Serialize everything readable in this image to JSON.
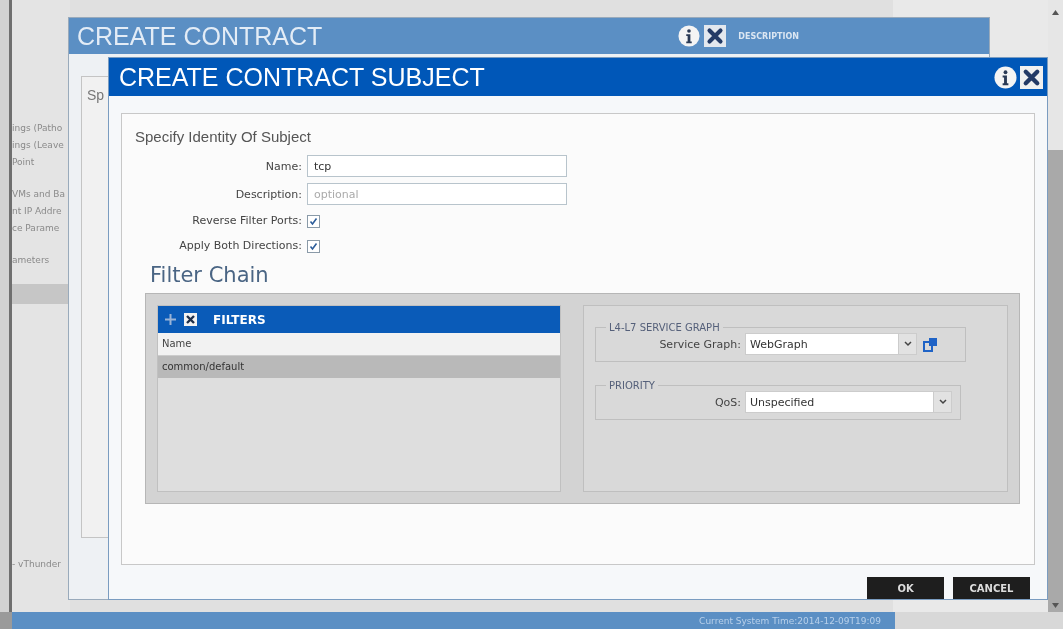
{
  "sidebar": {
    "groups": [
      [
        "ings (Patho",
        "ings (Leave",
        "Point"
      ],
      [
        "VMs and Ba",
        "nt IP Addre",
        "ce Parame"
      ],
      [
        "ameters"
      ]
    ],
    "footer_item": "- vThunder"
  },
  "background_dialog": {
    "title": "CREATE CONTRACT",
    "header_label": "DESCRIPTION",
    "panel_text": "Sp"
  },
  "dialog": {
    "title": "CREATE CONTRACT SUBJECT",
    "section_title": "Specify Identity Of Subject",
    "fields": [
      {
        "kind": "text",
        "label": "Name:",
        "value": "tcp"
      },
      {
        "kind": "text",
        "label": "Description:",
        "placeholder": "optional"
      },
      {
        "kind": "checkbox",
        "label": "Reverse Filter Ports:",
        "checked": true
      },
      {
        "kind": "checkbox",
        "label": "Apply Both Directions:",
        "checked": true
      }
    ],
    "filter_chain": {
      "title": "Filter Chain",
      "filters": {
        "title": "FILTERS",
        "columns": [
          "Name"
        ],
        "rows": [
          {
            "name": "common/default",
            "selected": true
          }
        ]
      },
      "service_graph": {
        "legend": "L4-L7 SERVICE GRAPH",
        "label": "Service Graph:",
        "value": "WebGraph"
      },
      "priority": {
        "legend": "PRIORITY",
        "label": "QoS:",
        "value": "Unspecified"
      }
    },
    "buttons": [
      "OK",
      "CANCEL"
    ]
  },
  "status_bar": {
    "text": "Current System Time:2014-12-09T19:09"
  }
}
